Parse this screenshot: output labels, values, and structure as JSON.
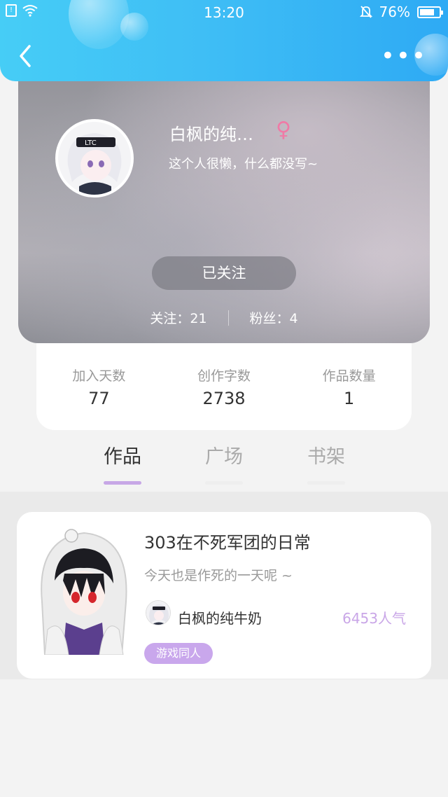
{
  "status_bar": {
    "time": "13:20",
    "battery_percent": "76%",
    "battery_level": 0.76
  },
  "header": {
    "more_label": "•••"
  },
  "profile": {
    "name": "白枫的纯…",
    "gender_symbol": "♀",
    "bio": "这个人很懒，什么都没写~",
    "follow_button": "已关注",
    "following": "关注：21",
    "followers": "粉丝：4"
  },
  "stats": [
    {
      "label": "加入天数",
      "value": "77"
    },
    {
      "label": "创作字数",
      "value": "2738"
    },
    {
      "label": "作品数量",
      "value": "1"
    }
  ],
  "tabs": [
    {
      "label": "作品",
      "active": true
    },
    {
      "label": "广场",
      "active": false
    },
    {
      "label": "书架",
      "active": false
    }
  ],
  "work": {
    "title": "303在不死军团的日常",
    "description": "今天也是作死的一天呢 ~",
    "author": "白枫的纯牛奶",
    "popularity": "6453人气",
    "tag": "游戏同人"
  },
  "colors": {
    "header_gradient_start": "#46cdf6",
    "header_gradient_end": "#2eaaf4",
    "accent_purple": "#c9a7ec",
    "gender_pink": "#f07aa6"
  }
}
